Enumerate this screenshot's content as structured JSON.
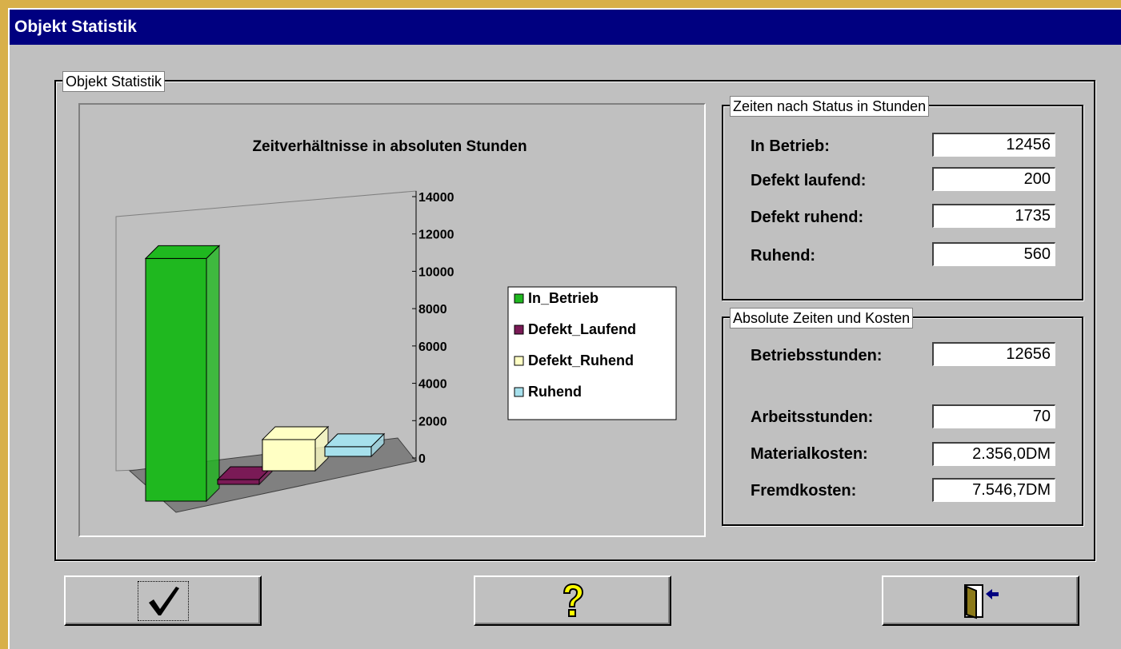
{
  "window": {
    "title": "Objekt Statistik"
  },
  "main_group": {
    "title": "Objekt Statistik"
  },
  "chart_data": {
    "type": "bar",
    "title": "Zeitverhältnisse in absoluten Stunden",
    "categories": [
      "In_Betrieb",
      "Defekt_Laufend",
      "Defekt_Ruhend",
      "Ruhend"
    ],
    "values": [
      12456,
      200,
      1735,
      560
    ],
    "colors": [
      "#1fb81f",
      "#7a1a56",
      "#ffffc4",
      "#a6e0ec"
    ],
    "ylim": [
      0,
      14000
    ],
    "yticks": [
      "14000",
      "12000",
      "10000",
      "8000",
      "6000",
      "4000",
      "2000",
      "0"
    ],
    "legend": [
      "In_Betrieb",
      "Defekt_Laufend",
      "Defekt_Ruhend",
      "Ruhend"
    ],
    "legend_position": "right",
    "grid": false
  },
  "status_group": {
    "title": "Zeiten nach Status in Stunden",
    "rows": [
      {
        "label": "In Betrieb:",
        "value": "12456"
      },
      {
        "label": "Defekt laufend:",
        "value": "200"
      },
      {
        "label": "Defekt ruhend:",
        "value": "1735"
      },
      {
        "label": "Ruhend:",
        "value": "560"
      }
    ]
  },
  "cost_group": {
    "title": "Absolute Zeiten und Kosten",
    "rows": [
      {
        "label": "Betriebsstunden:",
        "value": "12656"
      },
      {
        "label": "Arbeitsstunden:",
        "value": "70"
      },
      {
        "label": "Materialkosten:",
        "value": "2.356,0DM"
      },
      {
        "label": "Fremdkosten:",
        "value": "7.546,7DM"
      }
    ]
  },
  "buttons": {
    "ok_icon": "checkmark-icon",
    "help_icon": "question-mark-icon",
    "exit_icon": "exit-door-icon",
    "help_icon_color": "#ffff00",
    "exit_arrow_color": "#000080"
  }
}
